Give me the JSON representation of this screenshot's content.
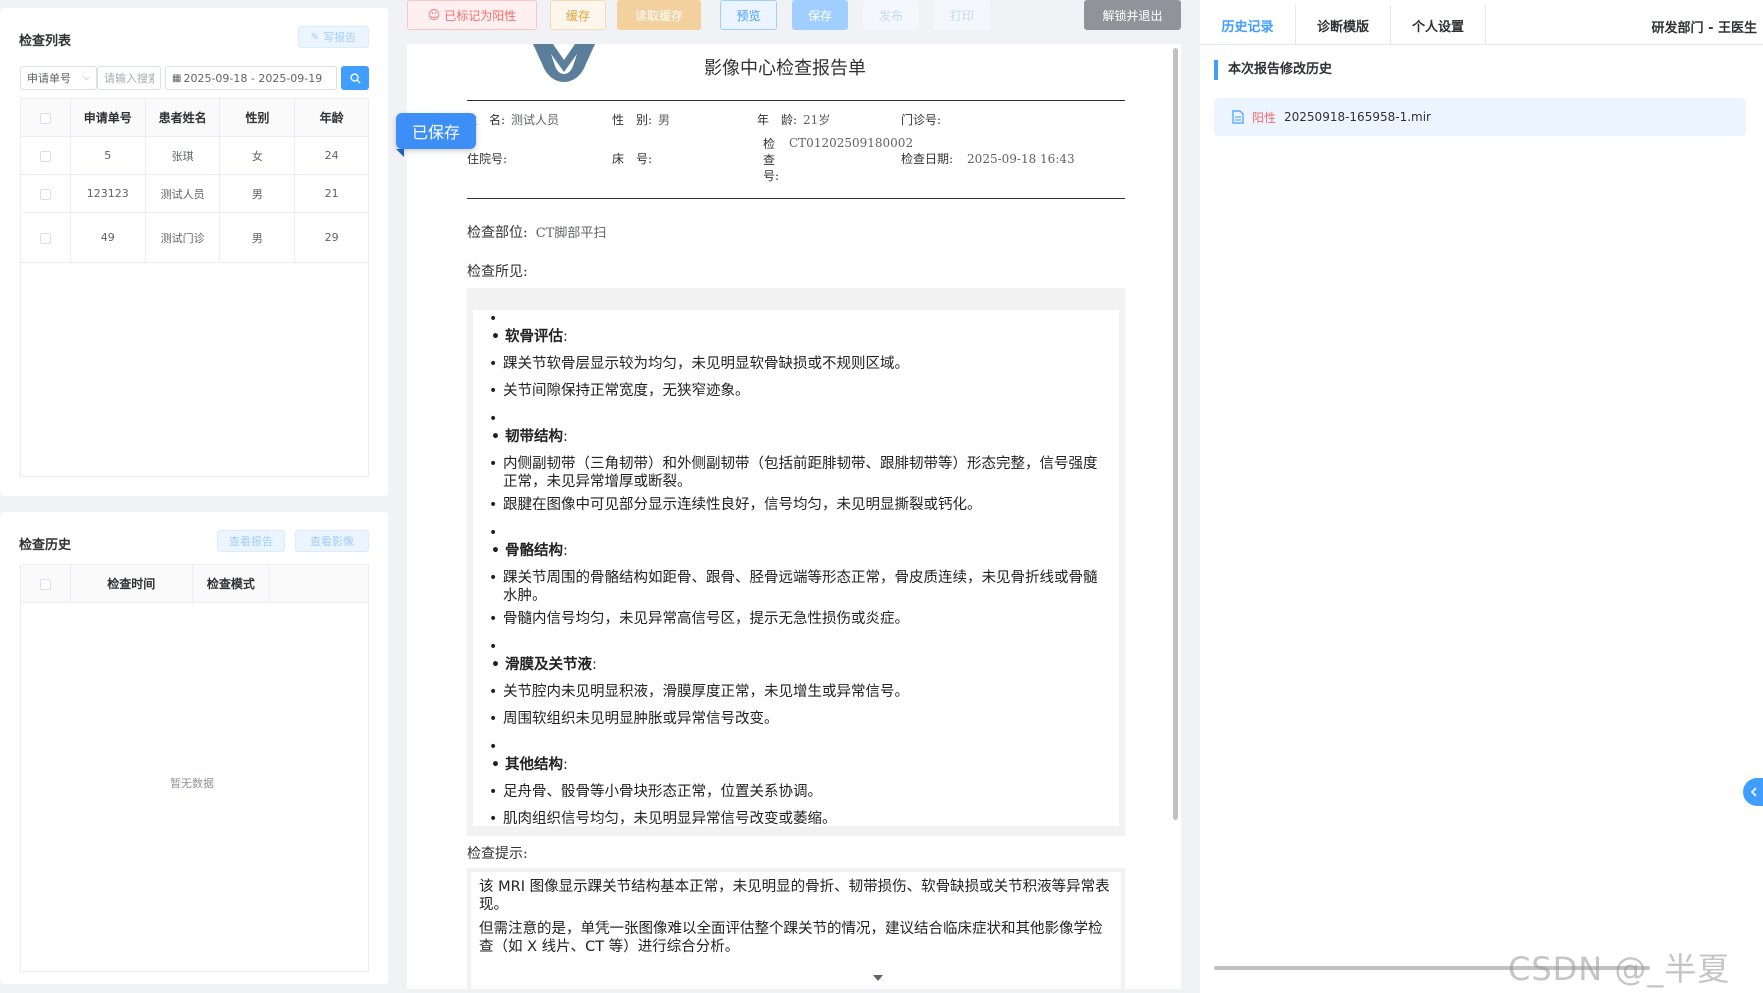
{
  "left": {
    "exam_list": {
      "title": "检查列表",
      "write_report_label": "写报告",
      "filter": {
        "select_value": "申请单号",
        "input_placeholder": "请输入搜索",
        "date_range": "2025-09-18 - 2025-09-19"
      },
      "columns": [
        "申请单号",
        "患者姓名",
        "性别",
        "年龄"
      ],
      "rows": [
        {
          "id": "5",
          "name": "张琪",
          "gender": "女",
          "age": "24"
        },
        {
          "id": "123123",
          "name": "测试人员",
          "gender": "男",
          "age": "21"
        },
        {
          "id": "49",
          "name": "测试门诊",
          "gender": "男",
          "age": "29"
        }
      ]
    },
    "exam_history": {
      "title": "检查历史",
      "view_report_label": "查看报告",
      "view_image_label": "查看影像",
      "columns": [
        "检查时间",
        "检查模式"
      ],
      "empty_text": "暂无数据"
    }
  },
  "toolbar": {
    "mark_positive": "已标记为阳性",
    "cache": "缓存",
    "read_cache": "读取缓存",
    "preview": "预览",
    "save": "保存",
    "publish": "发布",
    "print": "打印",
    "unlock_exit": "解锁并退出"
  },
  "saved_badge": "已保存",
  "report": {
    "title": "影像中心检查报告单",
    "fields": {
      "name_label": "姓　名:",
      "name_value": "测试人员",
      "gender_label": "性　别:",
      "gender_value": "男",
      "age_label": "年　龄:",
      "age_value": "21岁",
      "outpatient_label": "门诊号:",
      "inpatient_label": "住院号:",
      "bed_label": "床　号:",
      "exam_no_label": "检查号:",
      "exam_no_value": "CT01202509180002",
      "exam_date_label": "检查日期:",
      "exam_date_value": "2025-09-18 16:43"
    },
    "part_label": "检查部位:",
    "part_value": "CT脚部平扫",
    "findings_label": "检查所见:",
    "findings": [
      {
        "heading": "软骨评估",
        "items": [
          "踝关节软骨层显示较为均匀，未见明显软骨缺损或不规则区域。",
          "关节间隙保持正常宽度，无狭窄迹象。"
        ]
      },
      {
        "heading": "韧带结构",
        "items": [
          "内侧副韧带（三角韧带）和外侧副韧带（包括前距腓韧带、跟腓韧带等）形态完整，信号强度正常，未见异常增厚或断裂。",
          "跟腱在图像中可见部分显示连续性良好，信号均匀，未见明显撕裂或钙化。"
        ]
      },
      {
        "heading": "骨骼结构",
        "items": [
          "踝关节周围的骨骼结构如距骨、跟骨、胫骨远端等形态正常，骨皮质连续，未见骨折线或骨髓水肿。",
          "骨髓内信号均匀，未见异常高信号区，提示无急性损伤或炎症。"
        ]
      },
      {
        "heading": "滑膜及关节液",
        "items": [
          "关节腔内未见明显积液，滑膜厚度正常，未见增生或异常信号。",
          "周围软组织未见明显肿胀或异常信号改变。"
        ]
      },
      {
        "heading": "其他结构",
        "items": [
          "足舟骨、骰骨等小骨块形态正常，位置关系协调。",
          "肌肉组织信号均匀，未见明显异常信号改变或萎缩。"
        ]
      }
    ],
    "hints_label": "检查提示:",
    "hints": [
      "该 MRI 图像显示踝关节结构基本正常，未见明显的骨折、韧带损伤、软骨缺损或关节积液等异常表现。",
      "但需注意的是，单凭一张图像难以全面评估整个踝关节的情况，建议结合临床症状和其他影像学检查（如 X 线片、CT 等）进行综合分析。"
    ]
  },
  "right": {
    "tabs": [
      "历史记录",
      "诊断模版",
      "个人设置"
    ],
    "active_tab": 0,
    "user": "研发部门 - 王医生",
    "history_title": "本次报告修改历史",
    "history_items": [
      {
        "tag": "阳性",
        "file": "20250918-165958-1.mir"
      }
    ]
  },
  "watermark": "CSDN @_半夏曲",
  "colors": {
    "primary": "#409eff",
    "danger": "#f56c6c",
    "warning": "#e6a23c"
  }
}
